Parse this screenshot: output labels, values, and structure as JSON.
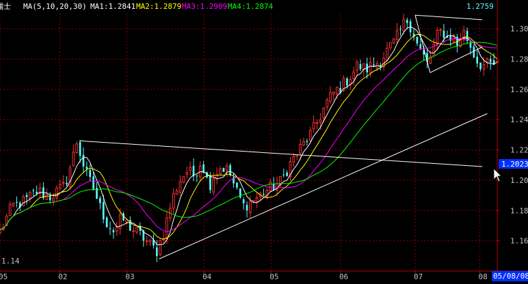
{
  "header": {
    "symbol": "瑞士",
    "ma_params": "MA(5,10,20,30)",
    "ma_items": [
      {
        "label": "MA1:1.2841",
        "color": "#ffffff"
      },
      {
        "label": "MA2:1.2879",
        "color": "#ffff00"
      },
      {
        "label": "MA3:1.2909",
        "color": "#ff00ff"
      },
      {
        "label": "MA4:1.2874",
        "color": "#00ff00"
      }
    ]
  },
  "colors": {
    "background": "#000000",
    "grid": "#8a0000",
    "axis": "#c00000",
    "up": "#ff3030",
    "down": "#54ffff",
    "ma1": "#ffffff",
    "ma2": "#ffff00",
    "ma3": "#ff00ff",
    "ma4": "#00ff00",
    "trendline": "#ffffff",
    "tick_text": "#c0c0c0",
    "last_price_text": "#54ffff",
    "price_tag_bg": "#0030ff",
    "date_tag_bg": "#0030ff"
  },
  "price_tag": "1.2023",
  "last_price": "1.2759",
  "min_price_label": "1.14",
  "date_tag": "05/08/08",
  "chart_data": {
    "type": "candlestick",
    "ylim": [
      1.14,
      1.31
    ],
    "y_ticks": [
      "1.30",
      "1.28",
      "1.26",
      "1.24",
      "1.22",
      "1.20",
      "1.18",
      "1.16",
      "1.14"
    ],
    "x_ticks": [
      "05",
      "02",
      "03",
      "04",
      "05",
      "06",
      "07",
      "08"
    ],
    "grid": true,
    "moving_averages": [
      {
        "name": "MA1",
        "period": 5,
        "last": 1.2841
      },
      {
        "name": "MA2",
        "period": 10,
        "last": 1.2879
      },
      {
        "name": "MA3",
        "period": 20,
        "last": 1.2909
      },
      {
        "name": "MA4",
        "period": 30,
        "last": 1.2874
      }
    ],
    "trendlines": [
      {
        "from": {
          "x": 0.16,
          "y": 1.226
        },
        "to": {
          "x": 0.97,
          "y": 1.209
        }
      },
      {
        "from": {
          "x": 0.32,
          "y": 1.148
        },
        "to": {
          "x": 0.98,
          "y": 1.244
        }
      },
      {
        "from": {
          "x": 0.835,
          "y": 1.309
        },
        "to": {
          "x": 0.97,
          "y": 1.306
        }
      },
      {
        "from": {
          "x": 0.865,
          "y": 1.271
        },
        "to": {
          "x": 0.97,
          "y": 1.288
        }
      },
      {
        "from": {
          "x": 0.835,
          "y": 1.309
        },
        "to": {
          "x": 0.865,
          "y": 1.271
        }
      }
    ],
    "anchors": [
      [
        0,
        1.166
      ],
      [
        0.025,
        1.183
      ],
      [
        0.05,
        1.186
      ],
      [
        0.075,
        1.193
      ],
      [
        0.1,
        1.189
      ],
      [
        0.13,
        1.196
      ],
      [
        0.145,
        1.213
      ],
      [
        0.155,
        1.226
      ],
      [
        0.165,
        1.213
      ],
      [
        0.175,
        1.203
      ],
      [
        0.19,
        1.193
      ],
      [
        0.2,
        1.183
      ],
      [
        0.215,
        1.172
      ],
      [
        0.23,
        1.166
      ],
      [
        0.245,
        1.175
      ],
      [
        0.265,
        1.168
      ],
      [
        0.285,
        1.163
      ],
      [
        0.3,
        1.158
      ],
      [
        0.315,
        1.153
      ],
      [
        0.33,
        1.166
      ],
      [
        0.345,
        1.186
      ],
      [
        0.36,
        1.199
      ],
      [
        0.375,
        1.206
      ],
      [
        0.39,
        1.203
      ],
      [
        0.405,
        1.213
      ],
      [
        0.42,
        1.196
      ],
      [
        0.43,
        1.203
      ],
      [
        0.445,
        1.209
      ],
      [
        0.46,
        1.206
      ],
      [
        0.475,
        1.193
      ],
      [
        0.49,
        1.183
      ],
      [
        0.505,
        1.186
      ],
      [
        0.52,
        1.189
      ],
      [
        0.535,
        1.193
      ],
      [
        0.55,
        1.196
      ],
      [
        0.565,
        1.199
      ],
      [
        0.58,
        1.209
      ],
      [
        0.6,
        1.219
      ],
      [
        0.615,
        1.226
      ],
      [
        0.63,
        1.233
      ],
      [
        0.645,
        1.243
      ],
      [
        0.66,
        1.253
      ],
      [
        0.675,
        1.259
      ],
      [
        0.69,
        1.263
      ],
      [
        0.705,
        1.269
      ],
      [
        0.72,
        1.276
      ],
      [
        0.735,
        1.273
      ],
      [
        0.75,
        1.276
      ],
      [
        0.765,
        1.279
      ],
      [
        0.78,
        1.286
      ],
      [
        0.795,
        1.292
      ],
      [
        0.81,
        1.302
      ],
      [
        0.82,
        1.306
      ],
      [
        0.83,
        1.299
      ],
      [
        0.84,
        1.289
      ],
      [
        0.85,
        1.283
      ],
      [
        0.86,
        1.276
      ],
      [
        0.87,
        1.286
      ],
      [
        0.88,
        1.296
      ],
      [
        0.89,
        1.299
      ],
      [
        0.9,
        1.293
      ],
      [
        0.91,
        1.296
      ],
      [
        0.92,
        1.289
      ],
      [
        0.93,
        1.299
      ],
      [
        0.94,
        1.293
      ],
      [
        0.95,
        1.286
      ],
      [
        0.958,
        1.279
      ],
      [
        0.97,
        1.276
      ]
    ]
  }
}
